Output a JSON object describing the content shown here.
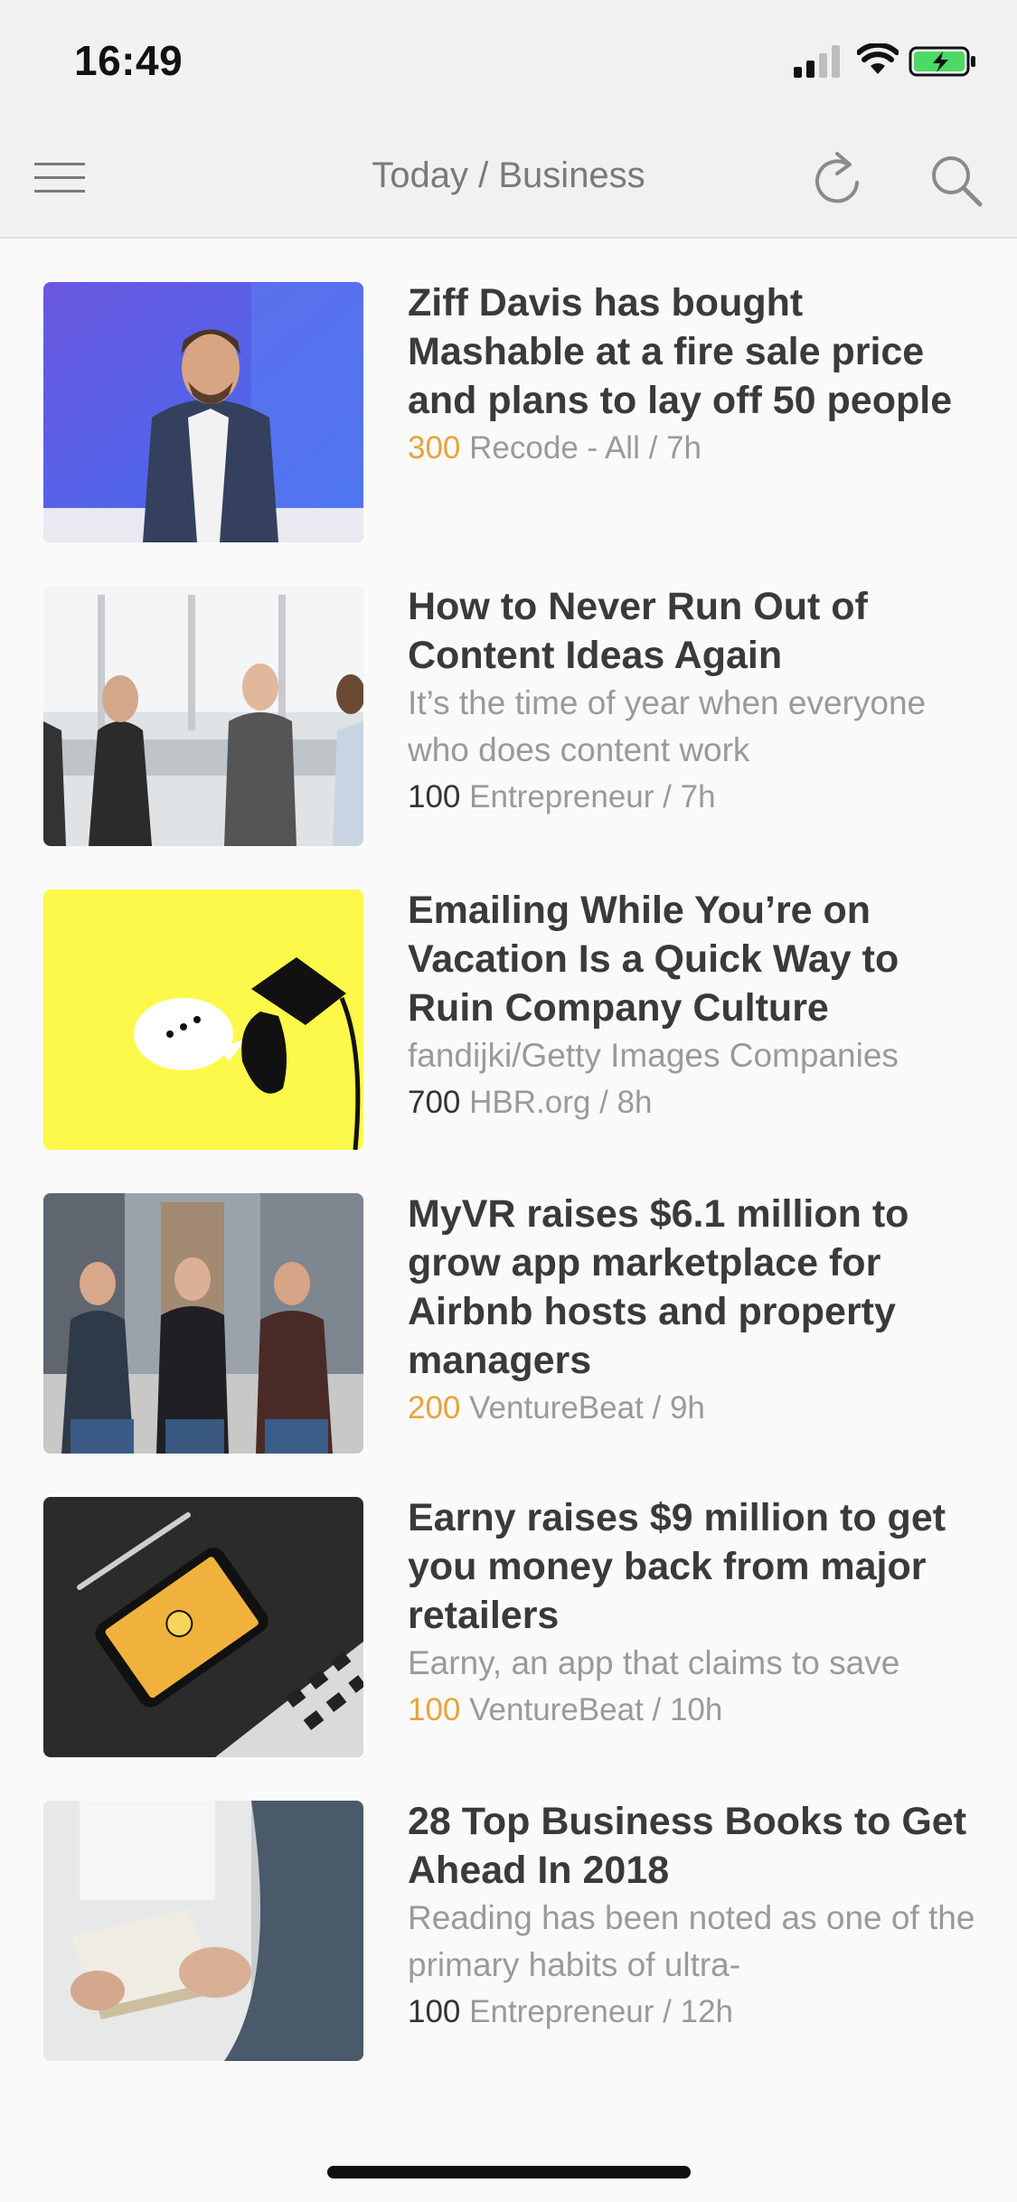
{
  "status_bar": {
    "time": "16:49",
    "icons": [
      "cellular-signal-icon",
      "wifi-icon",
      "battery-charging-icon"
    ],
    "battery_color": "#4cd964"
  },
  "nav": {
    "title": "Today / Business",
    "icons": [
      "hamburger-menu-icon",
      "refresh-icon",
      "search-icon"
    ]
  },
  "colors": {
    "accent_count": "#e9a23b",
    "headline": "#3a3a3a",
    "meta": "#9a9a9a"
  },
  "articles": [
    {
      "title": "Ziff Davis has bought Mashable at a fire sale price and plans to lay off 50 people",
      "summary": "",
      "count": "300",
      "count_hot": true,
      "source": "Recode - All / 7h"
    },
    {
      "title": "How to Never Run Out of Content Ideas Again",
      "summary": "It’s the time of year when everyone who does content work",
      "count": "100",
      "count_hot": false,
      "source": "Entrepreneur / 7h"
    },
    {
      "title": "Emailing While You’re on Vacation Is a Quick Way to Ruin Company Culture",
      "summary": "fandijki/Getty Images Companies",
      "count": "700",
      "count_hot": false,
      "source": "HBR.org / 8h"
    },
    {
      "title": "MyVR raises $6.1 million to grow app marketplace for Airbnb hosts and property managers",
      "summary": "",
      "count": "200",
      "count_hot": true,
      "source": "VentureBeat / 9h"
    },
    {
      "title": "Earny raises $9 million to get you money back from major retailers",
      "summary": "Earny, an app that claims to save",
      "count": "100",
      "count_hot": true,
      "source": "VentureBeat / 10h"
    },
    {
      "title": "28 Top Business Books to Get Ahead In 2018",
      "summary": "Reading has been noted as one of the primary habits of ultra-",
      "count": "100",
      "count_hot": false,
      "source": "Entrepreneur / 12h"
    }
  ]
}
